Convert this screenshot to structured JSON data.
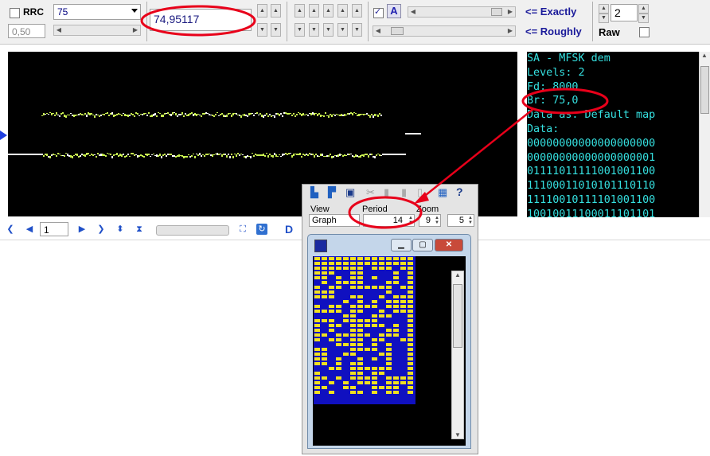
{
  "toolbar": {
    "rrc_label": "RRC",
    "rrc_checked": false,
    "rolloff_value": "0,50",
    "baud_select": "75",
    "baud_exact": "74,95117",
    "text_mode_checked": true,
    "font_icon_label": "A",
    "exactly_label": "<= Exactly",
    "roughly_label": "<= Roughly",
    "levels_value": "2",
    "raw_label": "Raw",
    "raw_checked": false
  },
  "terminal": {
    "lines": [
      "SA - MFSK dem",
      "Levels: 2",
      "Fd: 8000",
      "Br: 75,0",
      "Data as: Default map",
      "Data:",
      "00000000000000000000",
      "00000000000000000001",
      "01111011111001001100",
      "11100011010101110110",
      "11110010111101001100",
      "10010011100011101101"
    ]
  },
  "nav": {
    "page_value": "1",
    "d_label": "D"
  },
  "popup": {
    "view_label": "View",
    "view_value": "Graph",
    "period_label": "Period",
    "period_value": "14",
    "zoom_label": "Zoom",
    "zoom_x": "9",
    "zoom_y": "5"
  },
  "colors": {
    "highlight": "#e8001a",
    "trace": "#c8f050",
    "terminal_text": "#35e0e0",
    "grid_bg": "#1010c0",
    "grid_cell": "#f0e020"
  }
}
